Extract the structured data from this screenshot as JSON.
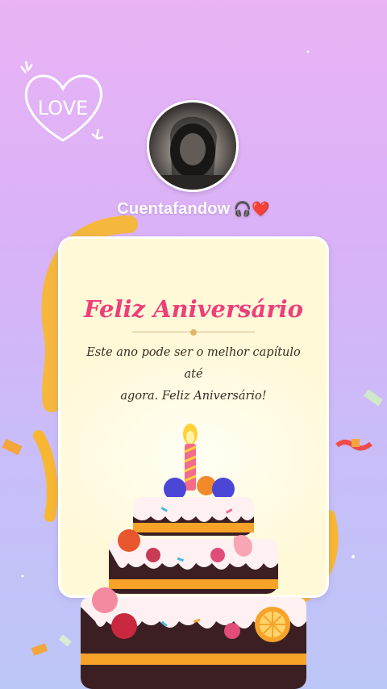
{
  "doodle": {
    "text": "LOVE"
  },
  "profile": {
    "username": "Cuentafandow",
    "emojis": "🎧❤️"
  },
  "card": {
    "title": "Feliz Aniversário",
    "message_line1": "Este ano pode ser o melhor capítulo até",
    "message_line2": "agora. Feliz Aniversário!"
  },
  "colors": {
    "title": "#ee3f7b",
    "card_bg": "#fff9d8",
    "background_top": "#e9b3f5",
    "background_bottom": "#bcc6f6"
  }
}
